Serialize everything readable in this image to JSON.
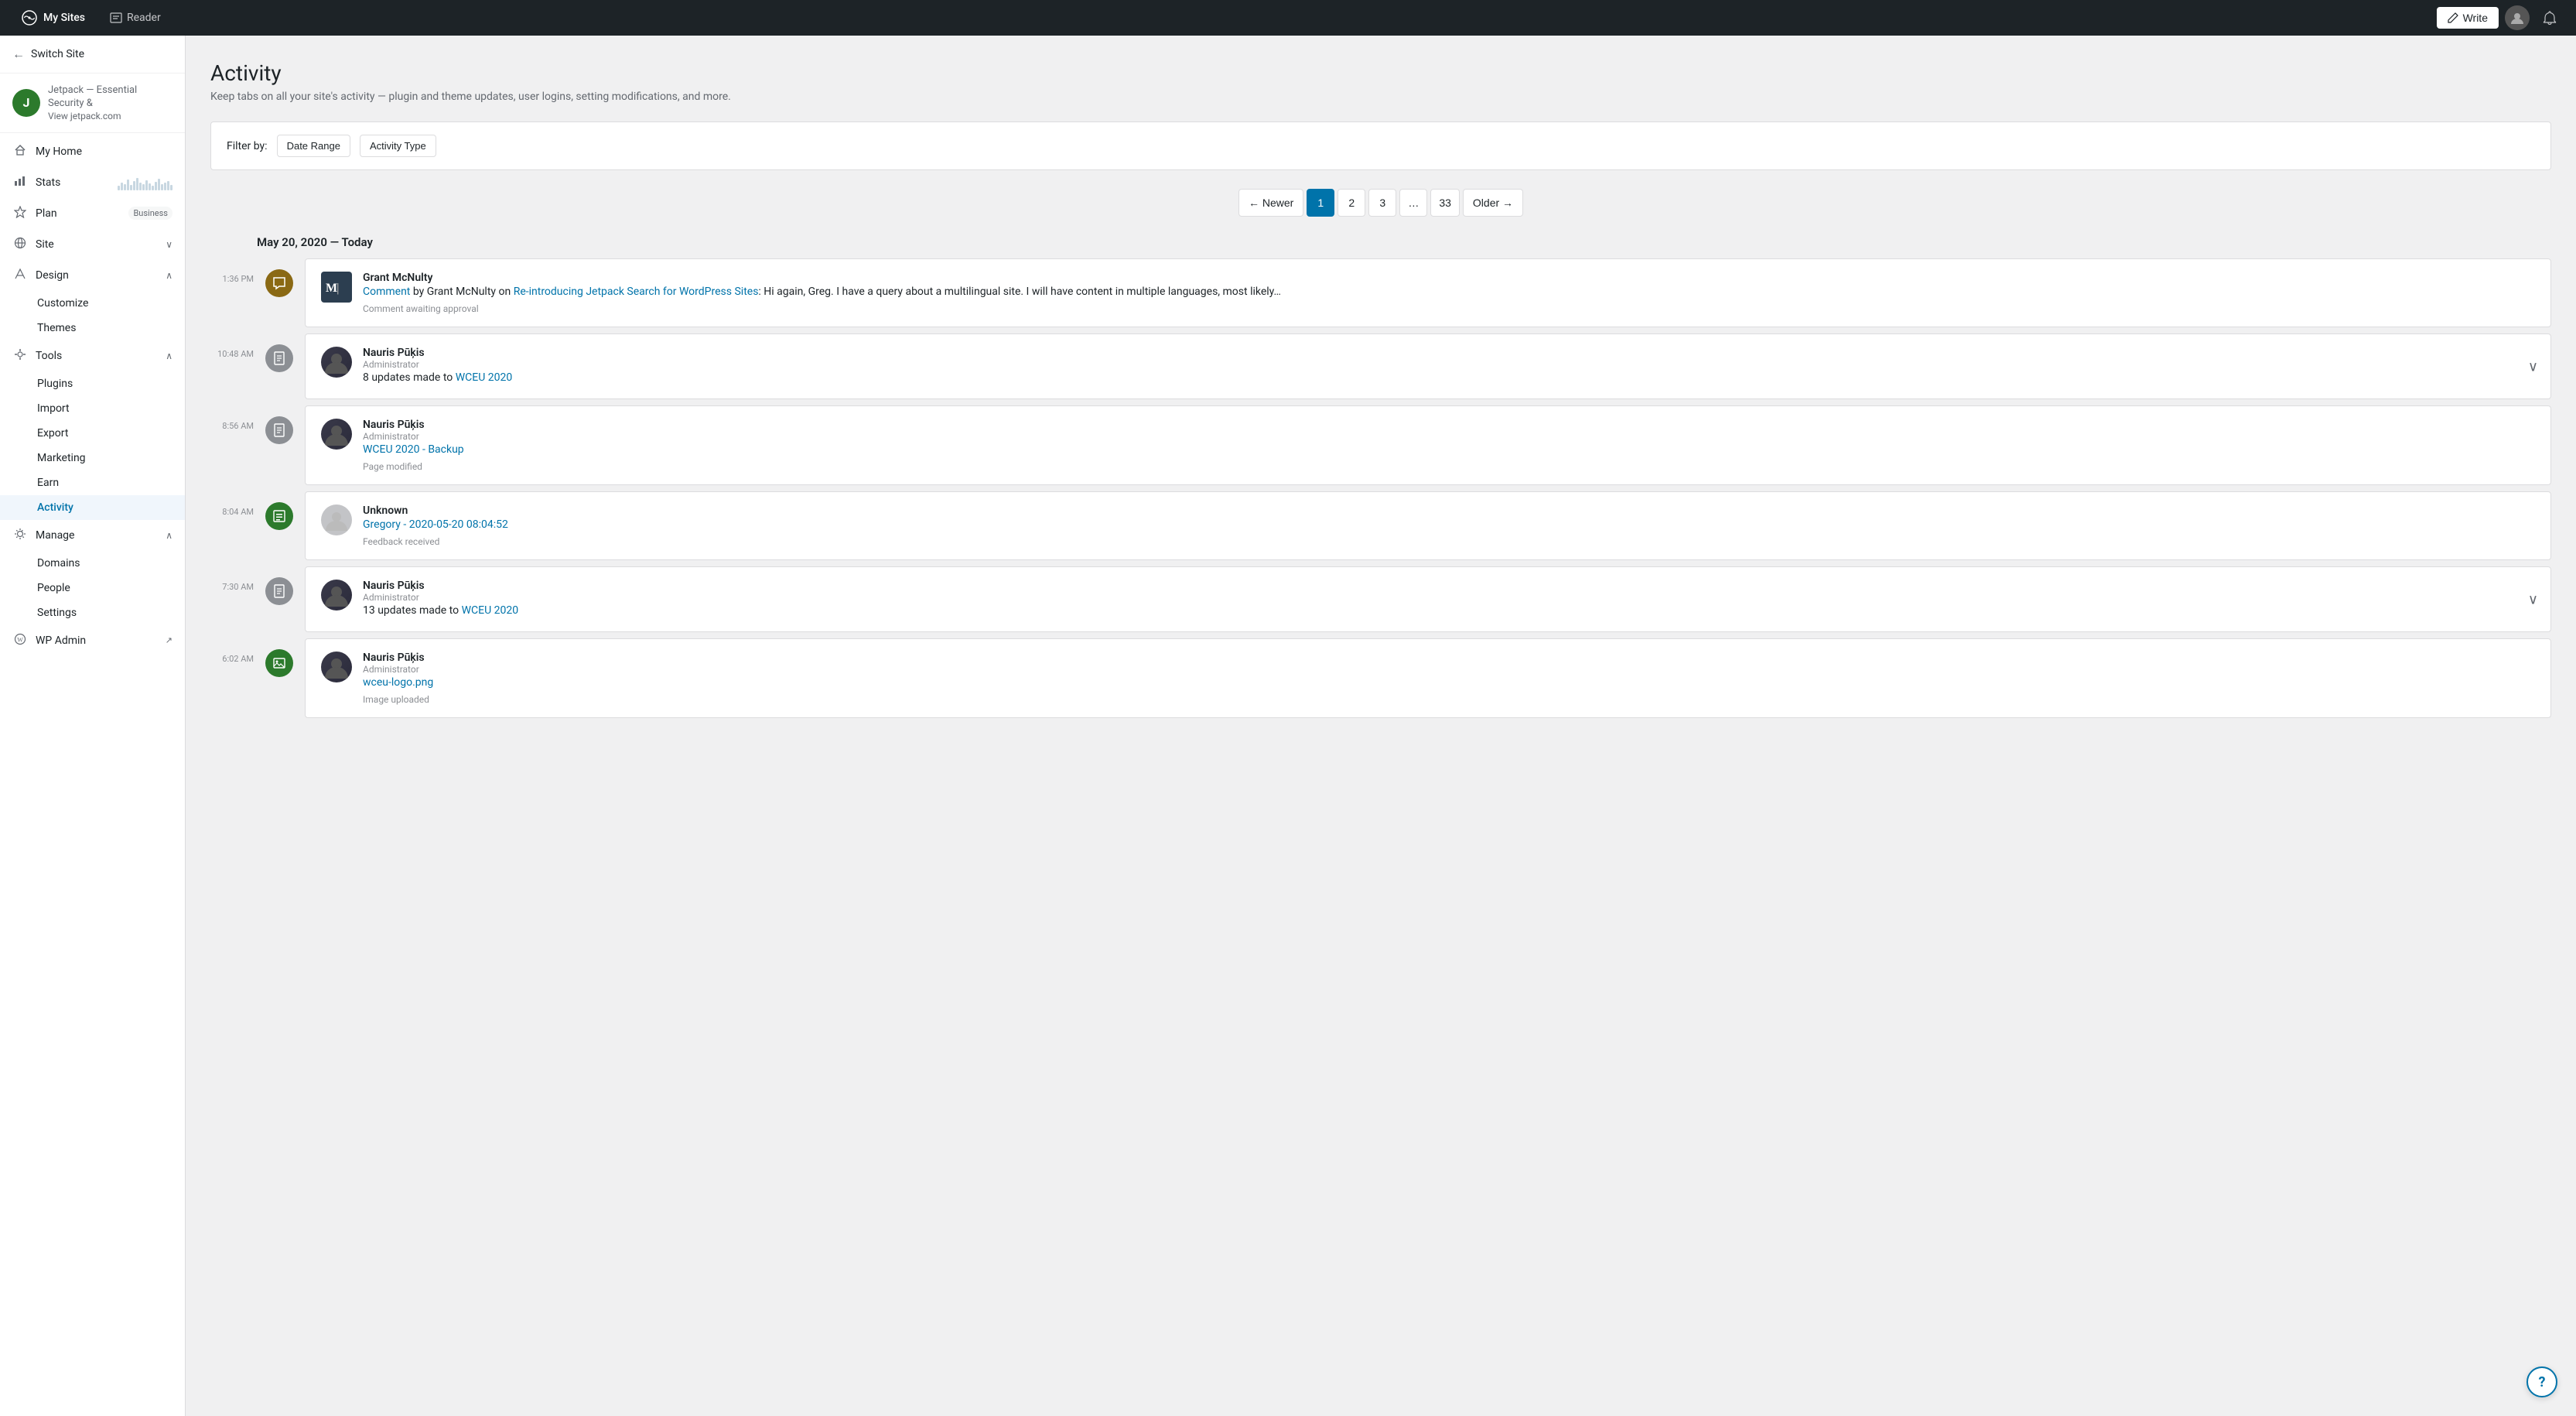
{
  "topNav": {
    "brand": "My Sites",
    "reader": "Reader",
    "write_label": "Write"
  },
  "sidebar": {
    "switch_site": "Switch Site",
    "site_name": "Jetpack — Essential Security",
    "site_name_suffix": " &",
    "site_url": "View jetpack.com",
    "nav_items": [
      {
        "id": "my-home",
        "label": "My Home",
        "icon": "🏠",
        "has_chevron": false
      },
      {
        "id": "stats",
        "label": "Stats",
        "icon": "📊",
        "has_chevron": false,
        "has_chart": true
      },
      {
        "id": "plan",
        "label": "Plan",
        "icon": "⚡",
        "badge": "Business",
        "has_chevron": false
      },
      {
        "id": "site",
        "label": "Site",
        "icon": "🌐",
        "has_chevron": true,
        "expanded": false
      },
      {
        "id": "design",
        "label": "Design",
        "icon": "✏️",
        "has_chevron": true,
        "expanded": true
      },
      {
        "id": "tools",
        "label": "Tools",
        "icon": "🔧",
        "has_chevron": true,
        "expanded": true
      },
      {
        "id": "manage",
        "label": "Manage",
        "icon": "⚙️",
        "has_chevron": true,
        "expanded": true
      }
    ],
    "design_sub": [
      "Customize",
      "Themes"
    ],
    "tools_sub": [
      "Plugins",
      "Import",
      "Export",
      "Marketing",
      "Earn",
      "Activity"
    ],
    "manage_sub": [
      "Domains",
      "People",
      "Settings"
    ],
    "wp_admin": "WP Admin"
  },
  "page": {
    "title": "Activity",
    "subtitle": "Keep tabs on all your site's activity — plugin and theme updates, user logins, setting modifications, and more."
  },
  "filter": {
    "label": "Filter by:",
    "btn_date": "Date Range",
    "btn_type": "Activity Type"
  },
  "pagination": {
    "newer": "← Newer",
    "page1": "1",
    "page2": "2",
    "page3": "3",
    "ellipsis": "…",
    "page33": "33",
    "older": "Older →"
  },
  "date_header": "May 20, 2020 — Today",
  "activities": [
    {
      "time": "1:36 PM",
      "icon_type": "comment",
      "icon_symbol": "💬",
      "user_name": "Grant McNulty",
      "user_role": null,
      "avatar_type": "initial",
      "avatar_initial": "M",
      "action_text": "Comment",
      "action_suffix": " by Grant McNulty on ",
      "link_text": "Re-introducing Jetpack Search for WordPress Sites",
      "description": ": Hi again, Greg. I have a query about a multilingual site. I will have content in multiple languages, most likely…",
      "meta": "Comment awaiting approval",
      "expandable": false
    },
    {
      "time": "10:48 AM",
      "icon_type": "update",
      "icon_symbol": "📄",
      "user_name": "Nauris Pūķis",
      "user_role": "Administrator",
      "avatar_type": "photo",
      "action_text": "8 updates made to ",
      "link_text": "WCEU 2020",
      "description": "",
      "meta": "",
      "expandable": true
    },
    {
      "time": "8:56 AM",
      "icon_type": "update",
      "icon_symbol": "📄",
      "user_name": "Nauris Pūķis",
      "user_role": "Administrator",
      "avatar_type": "photo",
      "action_text": "",
      "link_text": "WCEU 2020 - Backup",
      "description": "",
      "meta": "Page modified",
      "expandable": false
    },
    {
      "time": "8:04 AM",
      "icon_type": "form",
      "icon_symbol": "📋",
      "user_name": "Unknown",
      "user_role": null,
      "avatar_type": "unknown",
      "action_text": "",
      "link_text": "Gregory - 2020-05-20 08:04:52",
      "description": "",
      "meta": "Feedback received",
      "expandable": false
    },
    {
      "time": "7:30 AM",
      "icon_type": "update",
      "icon_symbol": "📄",
      "user_name": "Nauris Pūķis",
      "user_role": "Administrator",
      "avatar_type": "photo",
      "action_text": "13 updates made to ",
      "link_text": "WCEU 2020",
      "description": "",
      "meta": "",
      "expandable": true
    },
    {
      "time": "6:02 AM",
      "icon_type": "image",
      "icon_symbol": "🖼️",
      "user_name": "Nauris Pūķis",
      "user_role": "Administrator",
      "avatar_type": "photo",
      "action_text": "",
      "link_text": "wceu-logo.png",
      "description": "",
      "meta": "Image uploaded",
      "expandable": false
    }
  ],
  "help": "?"
}
